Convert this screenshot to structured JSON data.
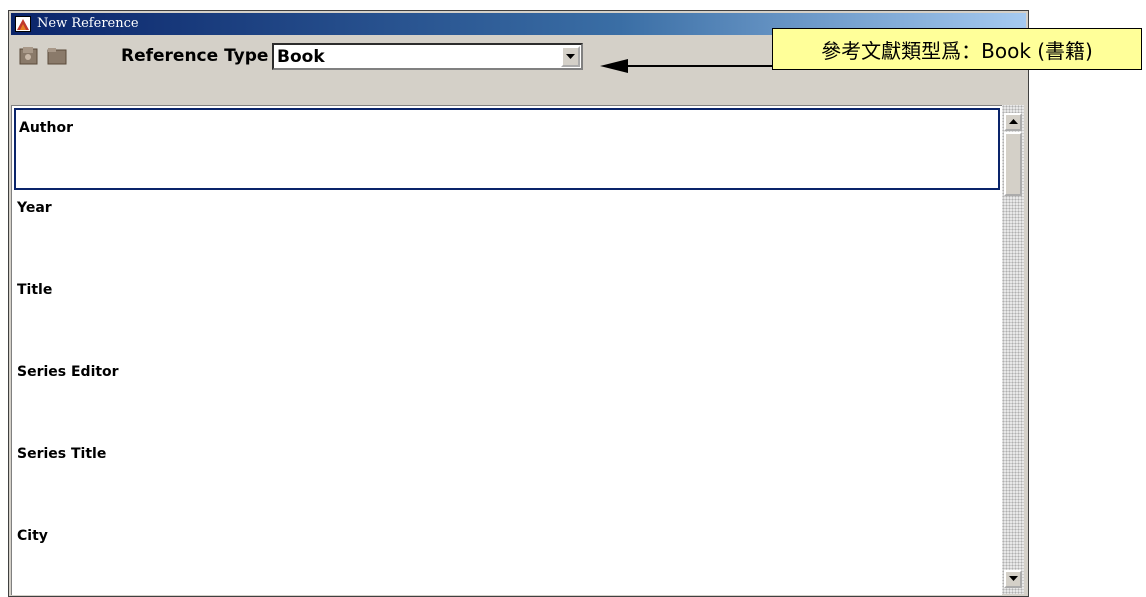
{
  "window": {
    "title": "New Reference"
  },
  "toolbar": {
    "reference_type_label": "Reference Type",
    "reference_type_value": "Book"
  },
  "fields": [
    {
      "label": "Author"
    },
    {
      "label": "Year"
    },
    {
      "label": "Title"
    },
    {
      "label": "Series Editor"
    },
    {
      "label": "Series Title"
    },
    {
      "label": "City"
    }
  ],
  "annotation": {
    "text": "參考文獻類型爲：Book (書籍)"
  },
  "colors": {
    "titlebar": "#0a246a",
    "window_face": "#d4d0c8",
    "callout_bg": "#ffff99"
  }
}
